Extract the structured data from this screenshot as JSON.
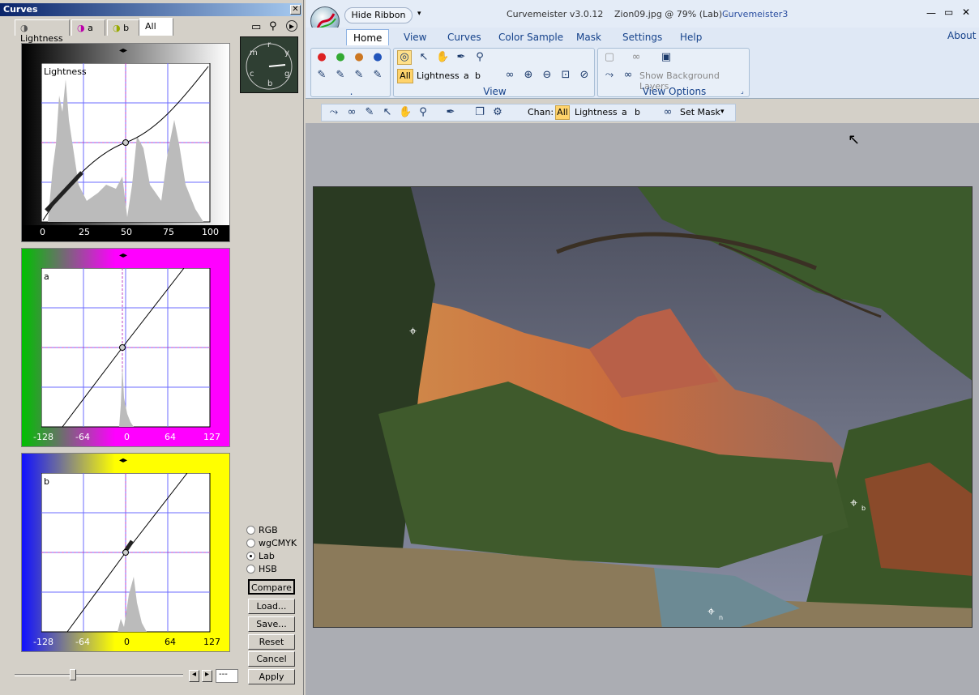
{
  "curves_panel": {
    "title": "Curves",
    "tabs": [
      {
        "label": "Lightness"
      },
      {
        "label": "a"
      },
      {
        "label": "b"
      },
      {
        "label": "All"
      }
    ],
    "graphs": [
      {
        "name": "Lightness",
        "ticks": [
          "0",
          "25",
          "50",
          "75",
          "100"
        ],
        "bg": "#ffffff"
      },
      {
        "name": "a",
        "ticks": [
          "-128",
          "-64",
          "0",
          "64",
          "127"
        ],
        "bg": "#ff00ff"
      },
      {
        "name": "b",
        "ticks": [
          "-128",
          "-64",
          "0",
          "64",
          "127"
        ],
        "bg": "#ffff00"
      }
    ],
    "modes": [
      "RGB",
      "wgCMYK",
      "Lab",
      "HSB"
    ],
    "selected_mode": "Lab",
    "buttons": {
      "compare": "Compare",
      "load": "Load...",
      "save": "Save...",
      "reset": "Reset",
      "cancel": "Cancel",
      "apply": "Apply"
    },
    "slider_field": "---",
    "clock_letters": [
      "m",
      "r",
      "y",
      "c",
      "b",
      "g"
    ]
  },
  "app": {
    "hide_ribbon": "Hide Ribbon",
    "title": "Curvemeister v3.0.12",
    "doc": "Zion09.jpg @ 79% (Lab) -",
    "doc_brand": "Curvemeister3",
    "about": "About",
    "ribbon_tabs": [
      "Home",
      "View",
      "Curves",
      "Color Sample",
      "Mask",
      "Settings",
      "Help"
    ],
    "active_tab": "Home",
    "view_group": {
      "label": "View",
      "chan_all": "All",
      "chan_lightness": "Lightness",
      "chan_a": "a",
      "chan_b": "b",
      "dot": "."
    },
    "view_options": {
      "label": "View Options",
      "show_bg": "Show Background Layers"
    },
    "toolbar": {
      "chan_label": "Chan:",
      "all": "All",
      "lightness": "Lightness",
      "a": "a",
      "b": "b",
      "set_mask": "Set Mask"
    }
  },
  "photo": {
    "markers": [
      "b",
      "n"
    ]
  }
}
